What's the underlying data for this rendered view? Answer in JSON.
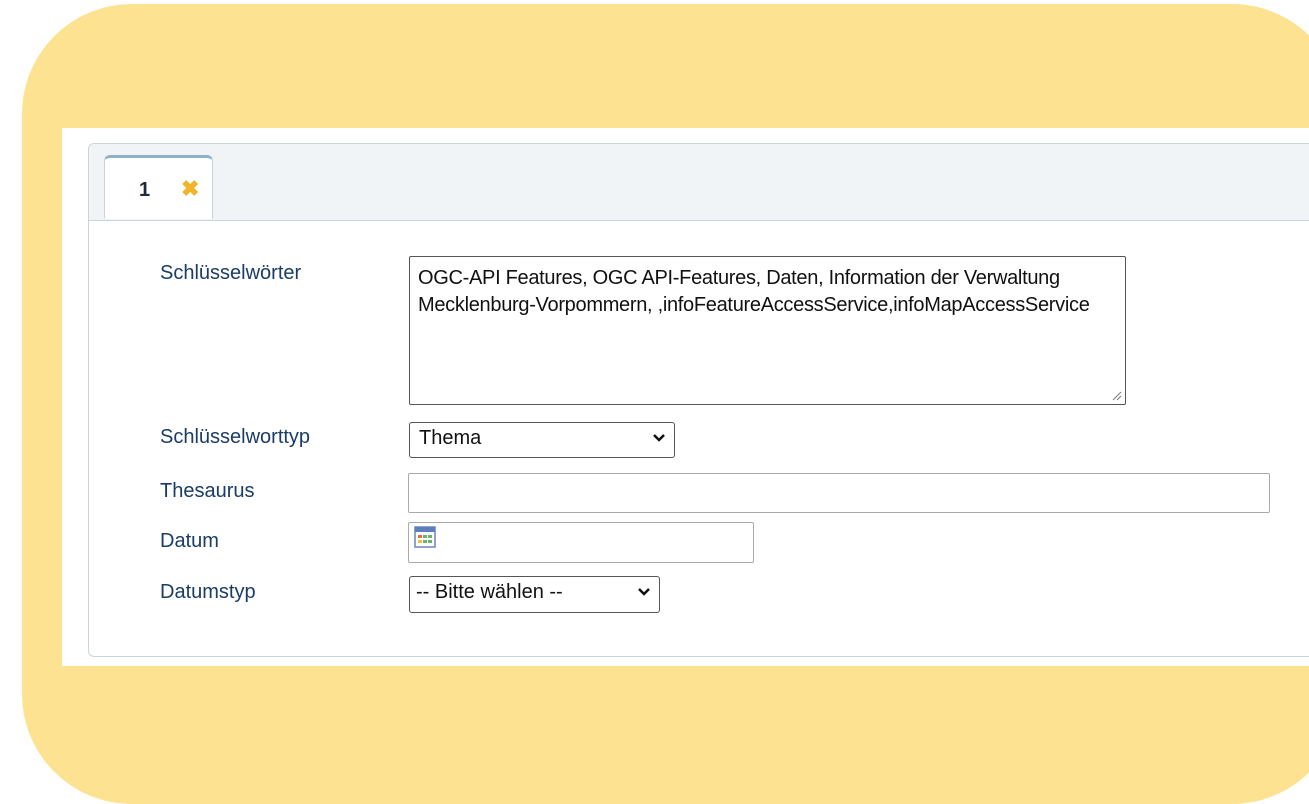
{
  "tab": {
    "label": "1",
    "close_icon": "close-icon"
  },
  "form": {
    "keywords": {
      "label": "Schlüsselwörter",
      "value": "OGC-API Features, OGC API-Features, Daten, Information der Verwaltung Mecklenburg-Vorpommern, ,infoFeatureAccessService,infoMapAccessService"
    },
    "keyword_type": {
      "label": "Schlüsselworttyp",
      "selected": "Thema"
    },
    "thesaurus": {
      "label": "Thesaurus",
      "value": ""
    },
    "date": {
      "label": "Datum",
      "value": "",
      "icon": "calendar-icon"
    },
    "date_type": {
      "label": "Datumstyp",
      "selected": "-- Bitte wählen --"
    }
  },
  "colors": {
    "frame_background": "#fde391",
    "label_text": "#1a3c66",
    "close_icon": "#f0b429"
  }
}
